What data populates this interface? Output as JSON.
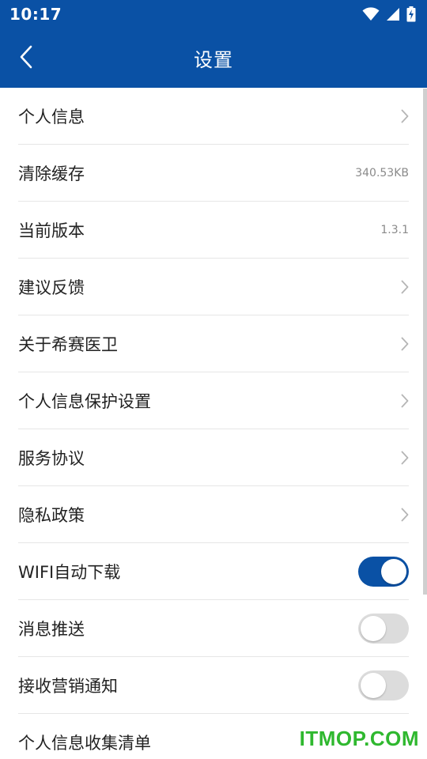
{
  "status_bar": {
    "time": "10:17"
  },
  "app_bar": {
    "title": "设置"
  },
  "settings": {
    "items": [
      {
        "label": "个人信息",
        "kind": "chevron"
      },
      {
        "label": "清除缓存",
        "kind": "value",
        "value": "340.53KB"
      },
      {
        "label": "当前版本",
        "kind": "value",
        "value": "1.3.1"
      },
      {
        "label": "建议反馈",
        "kind": "chevron"
      },
      {
        "label": "关于希赛医卫",
        "kind": "chevron"
      },
      {
        "label": "个人信息保护设置",
        "kind": "chevron"
      },
      {
        "label": "服务协议",
        "kind": "chevron"
      },
      {
        "label": "隐私政策",
        "kind": "chevron"
      },
      {
        "label": "WIFI自动下载",
        "kind": "toggle",
        "on": true
      },
      {
        "label": "消息推送",
        "kind": "toggle",
        "on": false
      },
      {
        "label": "接收营销通知",
        "kind": "toggle",
        "on": false
      },
      {
        "label": "个人信息收集清单",
        "kind": "none"
      }
    ]
  },
  "colors": {
    "primary": "#0a51a5",
    "toggle_off": "#dcdcdc",
    "chevron": "#b5b5b5"
  },
  "watermark": {
    "text": "ITMOP.COM"
  }
}
